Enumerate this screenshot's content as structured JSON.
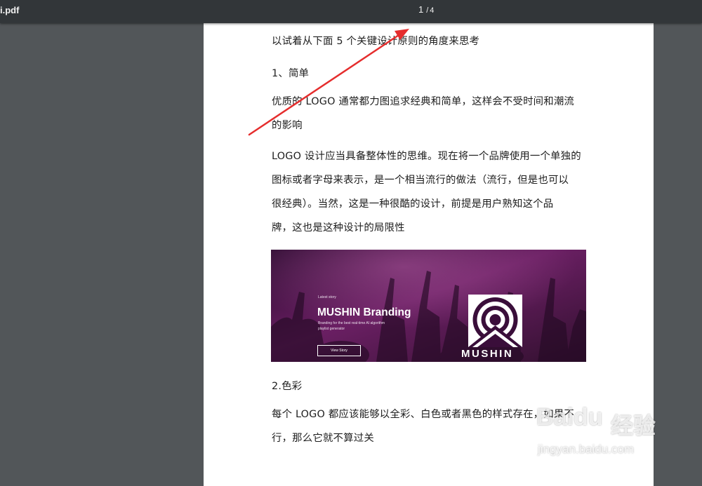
{
  "toolbar": {
    "file_name": "i.pdf",
    "current_page": "1",
    "separator": "/",
    "total_pages": "4"
  },
  "document": {
    "intro": "以试着从下面 5 个关键设计原则的角度来思考",
    "section1_heading": "1、简单",
    "para1": [
      "优质的 LOGO 通常都力图追求经典和简单，这样会不受时间和潮流",
      "的影响"
    ],
    "para2": [
      "LOGO 设计应当具备整体性的思维。现在将一个品牌使用一个单独的",
      "图标或者字母来表示，是一个相当流行的做法（流行，但是也可以",
      "很经典）。当然，这是一种很酷的设计，前提是用户熟知这个品",
      "牌，这也是这种设计的局限性"
    ],
    "banner": {
      "kicker": "Latest story",
      "title": "MUSHIN Branding",
      "description": "Branding for the best real-time AI algorithm playlist generator",
      "button": "View Story",
      "logo_word": "MUSHIN"
    },
    "section2_heading": "2.色彩",
    "para3": [
      "每个 LOGO 都应该能够以全彩、白色或者黑色的样式存在，如果不",
      "行，那么它就不算过关"
    ]
  },
  "watermark": {
    "brand_a": "Bai",
    "brand_b": "du",
    "brand_cn": "经验",
    "url": "jingyan.baidu.com"
  },
  "colors": {
    "toolbar_bg": "#323639",
    "viewer_bg": "#525659",
    "page_bg": "#ffffff",
    "annotation_arrow": "#e52d2d",
    "banner_bg": "#3a0e3a"
  }
}
